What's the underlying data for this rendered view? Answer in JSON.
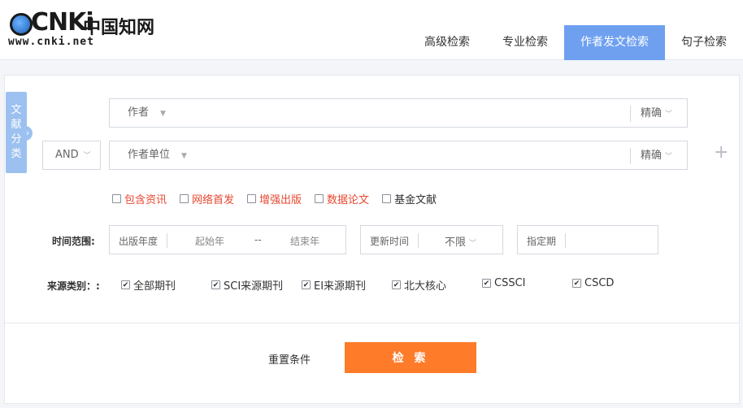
{
  "logo": {
    "word": "CNKi",
    "cn": "中国知网",
    "url": "www.cnki.net"
  },
  "tabs": [
    {
      "label": "高级检索",
      "active": false
    },
    {
      "label": "专业检索",
      "active": false
    },
    {
      "label": "作者发文检索",
      "active": true
    },
    {
      "label": "句子检索",
      "active": false
    }
  ],
  "sidebar": {
    "chars": [
      "文",
      "献",
      "分",
      "类"
    ],
    "arrow": "›"
  },
  "row1": {
    "field": "作者",
    "match": "精确"
  },
  "row2": {
    "logic": "AND",
    "field": "作者单位",
    "match": "精确"
  },
  "add_symbol": "+",
  "options": [
    {
      "label": "包含资讯",
      "checked": false,
      "highlight": true
    },
    {
      "label": "网络首发",
      "checked": false,
      "highlight": true
    },
    {
      "label": "增强出版",
      "checked": false,
      "highlight": true
    },
    {
      "label": "数据论文",
      "checked": false,
      "highlight": true
    },
    {
      "label": "基金文献",
      "checked": false,
      "highlight": false
    }
  ],
  "time": {
    "label": "时间范围:",
    "year_label": "出版年度",
    "start": "起始年",
    "dash": "--",
    "end": "结束年",
    "update_label": "更新时间",
    "update_value": "不限",
    "specified": "指定期"
  },
  "source": {
    "label": "来源类别：:",
    "items": [
      {
        "label": "全部期刊",
        "checked": true
      },
      {
        "label": "SCI来源期刊",
        "checked": true
      },
      {
        "label": "EI来源期刊",
        "checked": true
      },
      {
        "label": "北大核心",
        "checked": true
      },
      {
        "label": "CSSCI",
        "checked": true
      },
      {
        "label": "CSCD",
        "checked": true
      }
    ]
  },
  "actions": {
    "reset": "重置条件",
    "search": "检 索"
  },
  "colors": {
    "accent": "#6fa0f0",
    "search": "#fe7b29",
    "highlight": "#e8472f"
  }
}
